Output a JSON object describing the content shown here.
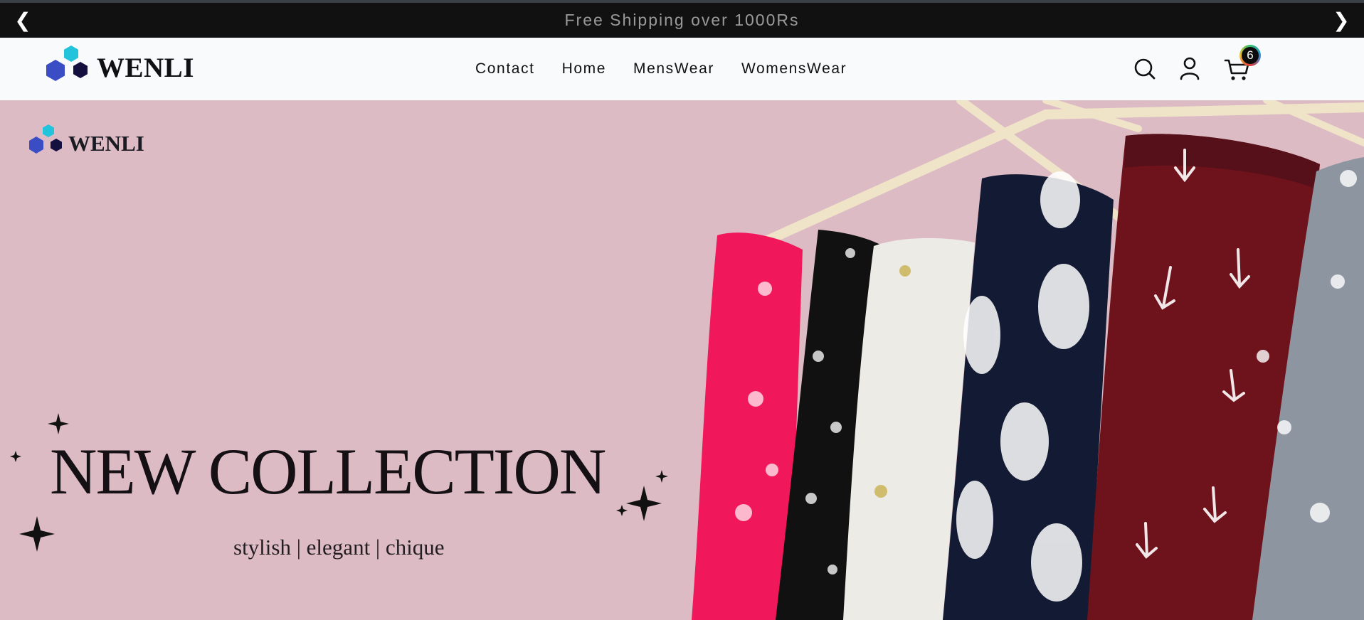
{
  "announcement": {
    "text": "Free Shipping over 1000Rs",
    "prev_icon": "chevron-left-icon",
    "next_icon": "chevron-right-icon"
  },
  "header": {
    "brand": "WENLI",
    "nav": [
      "Contact",
      "Home",
      "MensWear",
      "WomensWear"
    ],
    "cart_count": "6",
    "icons": [
      "search-icon",
      "account-icon",
      "cart-icon"
    ]
  },
  "hero": {
    "brand": "WENLI",
    "headline": "NEW COLLECTION",
    "tagline": "stylish | elegant | chique"
  },
  "colors": {
    "announcement_bg": "#111111",
    "header_bg": "#f9fafc",
    "hero_bg": "#ddbbc5",
    "logo_cyan": "#22c4dc",
    "logo_blue": "#3a4dc4",
    "logo_navy": "#131040"
  }
}
